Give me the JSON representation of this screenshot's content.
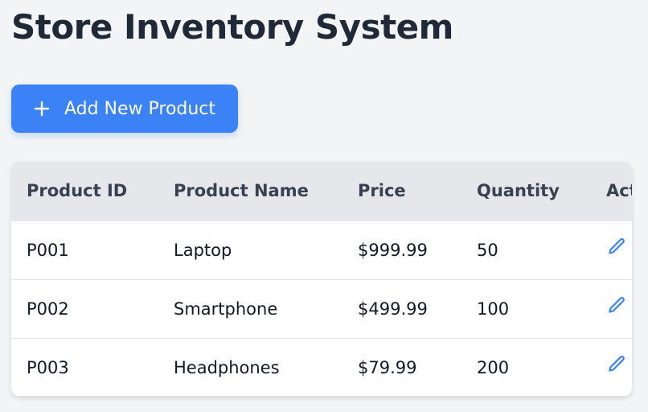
{
  "header": {
    "title": "Store Inventory System"
  },
  "toolbar": {
    "add_label": "Add New Product",
    "add_icon": "plus-icon",
    "accent": "#3b82f6"
  },
  "table": {
    "columns": [
      "Product ID",
      "Product Name",
      "Price",
      "Quantity",
      "Actions"
    ],
    "rows": [
      {
        "id": "P001",
        "name": "Laptop",
        "price": "$999.99",
        "quantity": "50"
      },
      {
        "id": "P002",
        "name": "Smartphone",
        "price": "$499.99",
        "quantity": "100"
      },
      {
        "id": "P003",
        "name": "Headphones",
        "price": "$79.99",
        "quantity": "200"
      }
    ],
    "actions": {
      "edit_icon": "pencil-icon",
      "delete_icon": "trash-icon",
      "edit_color": "#3b82f6",
      "delete_color": "#ef4444"
    }
  }
}
